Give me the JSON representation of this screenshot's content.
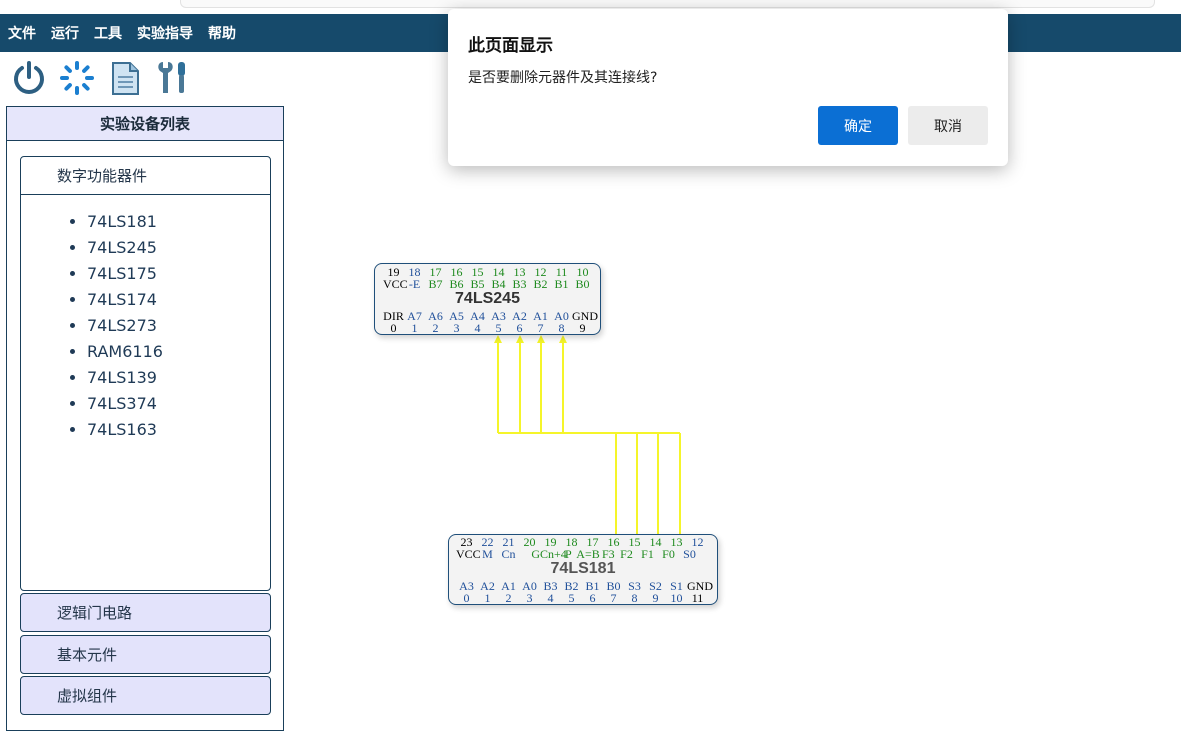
{
  "menu": {
    "items": [
      "文件",
      "运行",
      "工具",
      "实验指导",
      "帮助"
    ]
  },
  "toolbar": {
    "icons": [
      "power-icon",
      "loading-icon",
      "document-icon",
      "tools-icon"
    ]
  },
  "sidebar": {
    "header": "实验设备列表",
    "open_section": {
      "title": "数字功能器件",
      "items": [
        "74LS181",
        "74LS245",
        "74LS175",
        "74LS174",
        "74LS273",
        "RAM6116",
        "74LS139",
        "74LS374",
        "74LS163"
      ]
    },
    "closed_sections": [
      "逻辑门电路",
      "基本元件",
      "虚拟组件"
    ]
  },
  "chips": {
    "ls245": {
      "name": "74LS245",
      "top_nums": [
        "19",
        "18",
        "17",
        "16",
        "15",
        "14",
        "13",
        "12",
        "11",
        "10"
      ],
      "top_labels": [
        "VCC",
        "-E",
        "B7",
        "B6",
        "B5",
        "B4",
        "B3",
        "B2",
        "B1",
        "B0"
      ],
      "bottom_labels": [
        "DIR",
        "A7",
        "A6",
        "A5",
        "A4",
        "A3",
        "A2",
        "A1",
        "A0",
        "GND"
      ],
      "bottom_nums": [
        "0",
        "1",
        "2",
        "3",
        "4",
        "5",
        "6",
        "7",
        "8",
        "9"
      ]
    },
    "ls181": {
      "name": "74LS181",
      "top_nums": [
        "23",
        "22",
        "21",
        "20",
        "19",
        "18",
        "17",
        "16",
        "15",
        "14",
        "13",
        "12"
      ],
      "top_labels": [
        "VCC",
        "M",
        "Cn",
        "G",
        "Cn+4",
        "P",
        "A=B",
        "F3",
        "F2",
        "F1",
        "F0",
        "S0"
      ],
      "bottom_labels": [
        "A3",
        "A2",
        "A1",
        "A0",
        "B3",
        "B2",
        "B1",
        "B0",
        "S3",
        "S2",
        "S1",
        "GND"
      ],
      "bottom_nums": [
        "0",
        "1",
        "2",
        "3",
        "4",
        "5",
        "6",
        "7",
        "8",
        "9",
        "10",
        "11"
      ]
    }
  },
  "wire_color": "#f5f52a",
  "dialog": {
    "title": "此页面显示",
    "message": "是否要删除元器件及其连接线?",
    "ok_label": "确定",
    "cancel_label": "取消"
  }
}
